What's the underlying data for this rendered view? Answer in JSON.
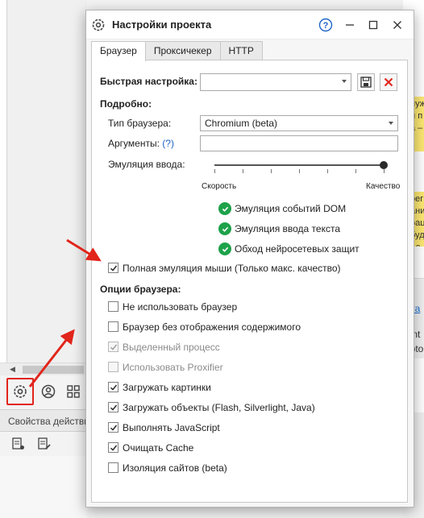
{
  "dialog": {
    "title": "Настройки проекта",
    "tabs": [
      {
        "label": "Браузер",
        "active": true
      },
      {
        "label": "Проксичекер",
        "active": false
      },
      {
        "label": "HTTP",
        "active": false
      }
    ]
  },
  "quick_setup": {
    "label": "Быстрая настройка:",
    "value": ""
  },
  "details": {
    "heading": "Подробно:",
    "browser_type_label": "Тип браузера:",
    "browser_type_value": "Chromium (beta)",
    "args_label": "Аргументы:",
    "args_help": "(?)",
    "args_value": "",
    "emulation_label": "Эмуляция ввода:",
    "slider_min_label": "Скорость",
    "slider_max_label": "Качество",
    "slider_level": 1.0
  },
  "emulation_features": [
    "Эмуляция событий DOM",
    "Эмуляция ввода текста",
    "Обход нейросетевых защит"
  ],
  "full_mouse": {
    "label": "Полная эмуляция мыши (Только макс. качество)",
    "checked": true
  },
  "browser_options": {
    "heading": "Опции браузера:",
    "items": [
      {
        "label": "Не использовать браузер",
        "checked": false,
        "disabled": false
      },
      {
        "label": "Браузер без отображения содержимого",
        "checked": false,
        "disabled": false
      },
      {
        "label": "Выделенный процесс",
        "checked": true,
        "disabled": true
      },
      {
        "label": "Использовать Proxifier",
        "checked": false,
        "disabled": true
      },
      {
        "label": "Загружать картинки",
        "checked": true,
        "disabled": false
      },
      {
        "label": "Загружать объекты (Flash, Silverlight, Java)",
        "checked": true,
        "disabled": false
      },
      {
        "label": "Выполнять JavaScript",
        "checked": true,
        "disabled": false
      },
      {
        "label": "Очищать Cache",
        "checked": true,
        "disabled": false
      },
      {
        "label": "Изоляция сайтов (beta)",
        "checked": false,
        "disabled": false
      }
    ]
  },
  "background": {
    "properties_panel_label": "Свойства действия",
    "right_fragments": {
      "yellow1": [
        "нуж",
        "и п",
        "а –"
      ],
      "yellow2": [
        "рег",
        "ани",
        "рац",
        "буд",
        "- с"
      ],
      "link": "il.ra",
      "text1": "ient",
      "text2": "apto"
    }
  },
  "colors": {
    "accent_blue": "#1e63c7",
    "danger_red": "#e1251b",
    "check_green": "#1ea24a",
    "note_yellow": "#fde873"
  }
}
